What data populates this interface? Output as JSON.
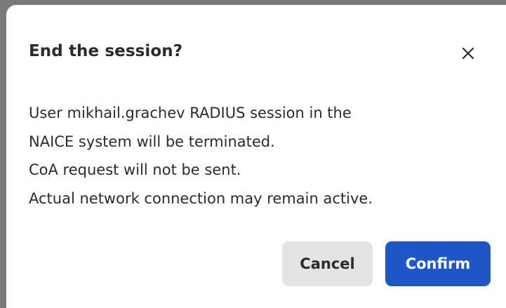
{
  "dialog": {
    "title": "End the session?",
    "close_icon": "close-icon",
    "message_lines": [
      "User mikhail.grachev RADIUS session in the",
      "NAICE system will be terminated.",
      "CoA request will not be sent.",
      "Actual network connection may remain active."
    ],
    "cancel_label": "Cancel",
    "confirm_label": "Confirm"
  },
  "colors": {
    "overlay": "#7a7a7a",
    "dialog_bg": "#ffffff",
    "text": "#2b2b2b",
    "cancel_bg": "#e4e4e4",
    "primary": "#1f57c8"
  }
}
